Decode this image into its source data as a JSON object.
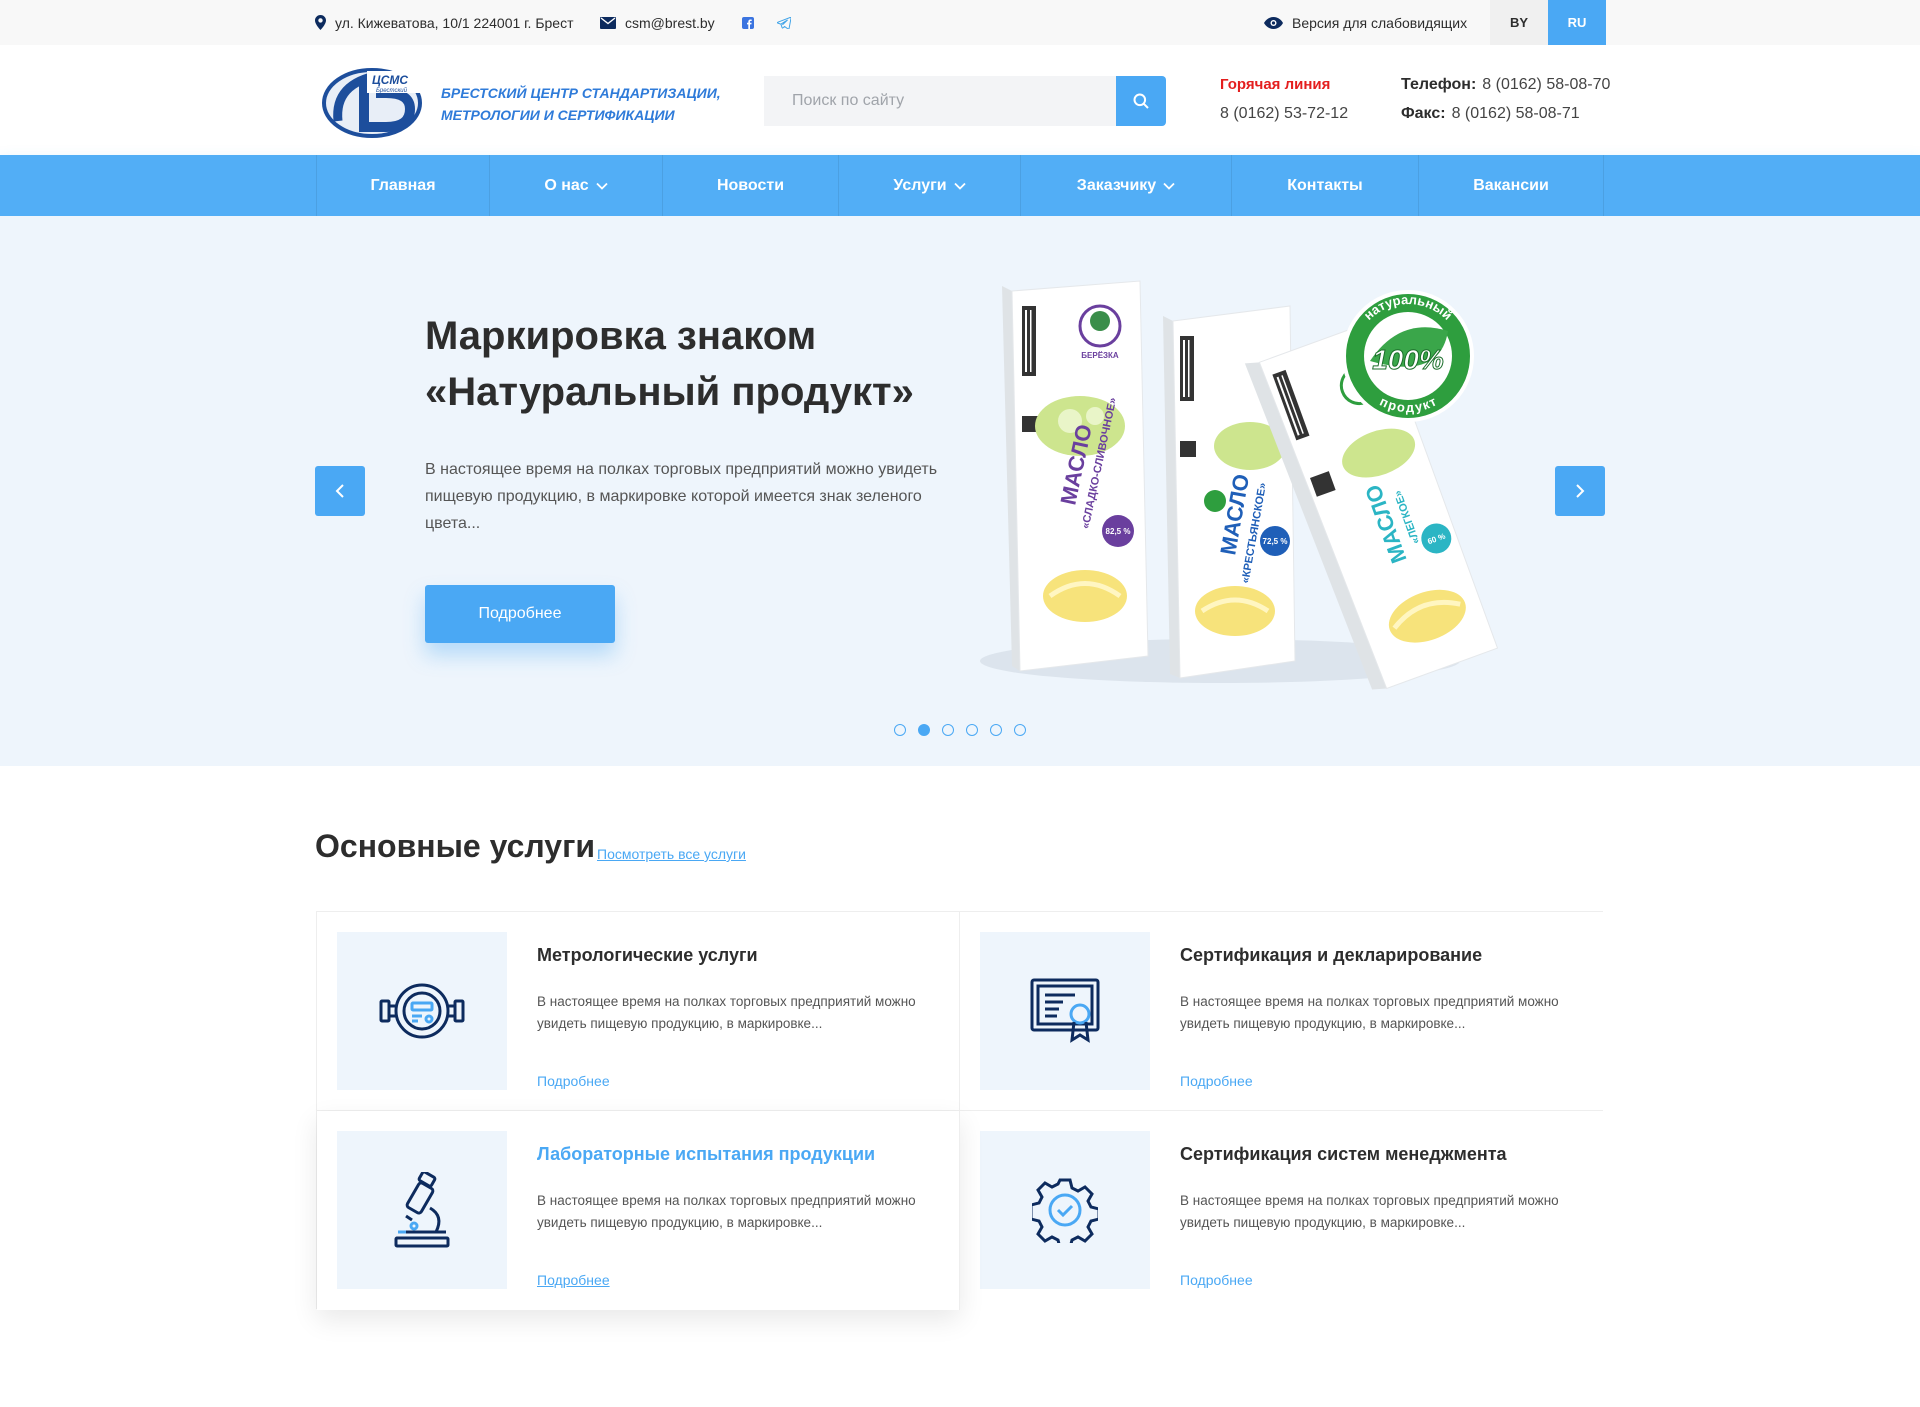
{
  "topbar": {
    "address": "ул. Кижеватова, 10/1 224001 г. Брест",
    "email": "csm@brest.by",
    "vision_label": "Версия для слабовидящих",
    "languages": [
      "BY",
      "RU"
    ],
    "active_language": "RU",
    "social_icons": [
      "facebook-icon",
      "telegram-icon"
    ]
  },
  "header": {
    "logo_text": "БРЕСТСКИЙ ЦЕНТР СТАНДАРТИЗАЦИИ, МЕТРОЛОГИИ И СЕРТИФИКАЦИИ",
    "logo_badge": "ЦСМС",
    "logo_badge_sub": "Брестский",
    "search_placeholder": "Поиск по сайту",
    "hotline_label": "Горячая линия",
    "hotline_phone": "8 (0162) 53-72-12",
    "phone_label": "Телефон:",
    "phone": "8 (0162) 58-08-70",
    "fax_label": "Факс:",
    "fax": "8 (0162) 58-08-71"
  },
  "nav": {
    "items": [
      {
        "label": "Главная",
        "has_dropdown": false
      },
      {
        "label": "О нас",
        "has_dropdown": true
      },
      {
        "label": "Новости",
        "has_dropdown": false
      },
      {
        "label": "Услуги",
        "has_dropdown": true
      },
      {
        "label": "Заказчику",
        "has_dropdown": true
      },
      {
        "label": "Контакты",
        "has_dropdown": false
      },
      {
        "label": "Вакансии",
        "has_dropdown": false
      }
    ]
  },
  "hero": {
    "title_line1": "Маркировка знаком",
    "title_line2": "«Натуральный продукт»",
    "text": "В настоящее время на полках торговых предприятий можно увидеть пищевую продукцию, в маркировке которой имеется знак зеленого цвета...",
    "button_label": "Подробнее",
    "slide_count": 6,
    "active_slide": 2,
    "image": {
      "badge_top": "натуральный",
      "badge_percent": "100%",
      "badge_bottom": "продукт",
      "pack_brand": "БЕРЁЗКА",
      "packs": [
        {
          "name": "МАСЛО",
          "variant": "«СЛАДКО-СЛИВОЧНОЕ»",
          "fat": "82,5 %",
          "accent": "#6a3f9e"
        },
        {
          "name": "МАСЛО",
          "variant": "«КРЕСТЬЯНСКОЕ»",
          "fat": "72,5 %",
          "accent": "#1f5fb8"
        },
        {
          "name": "МАСЛО",
          "variant": "«ЛЕГКОЕ»",
          "fat": "60 %",
          "accent": "#2bb5c4"
        }
      ]
    }
  },
  "services": {
    "title": "Основные услуги",
    "view_all": "Посмотреть все услуги",
    "items": [
      {
        "title": "Метрологические услуги",
        "text": "В настоящее время на полках торговых предприятий можно увидеть пищевую продукцию, в маркировке...",
        "link": "Подробнее",
        "icon": "water-meter-icon"
      },
      {
        "title": "Сертификация и декларирование",
        "text": "В настоящее время на полках торговых предприятий можно увидеть пищевую продукцию, в маркировке...",
        "link": "Подробнее",
        "icon": "certificate-icon"
      },
      {
        "title": "Лабораторные испытания продукции",
        "text": "В настоящее время на полках торговых предприятий можно увидеть пищевую продукцию, в маркировке...",
        "link": "Подробнее",
        "icon": "microscope-icon"
      },
      {
        "title": "Сертификация систем менеджмента",
        "text": "В настоящее время на полках торговых предприятий можно увидеть пищевую продукцию, в маркировке...",
        "link": "Подробнее",
        "icon": "gear-check-icon"
      }
    ]
  },
  "colors": {
    "accent": "#4aa8f4",
    "nav": "#52aef6",
    "hero_bg": "#eef5fc",
    "hotline": "#e41e1e",
    "icon_stroke": "#0d2b5e",
    "badge_green": "#2e9e3e"
  }
}
